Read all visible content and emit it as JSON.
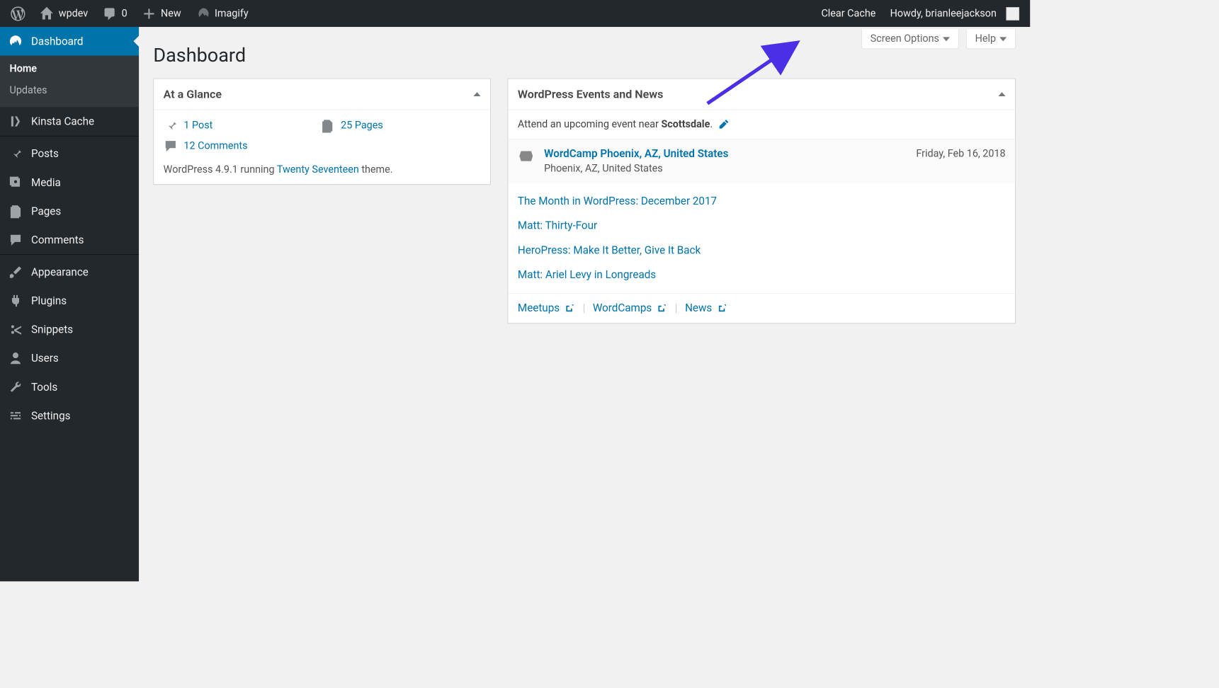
{
  "admin_bar": {
    "site_name": "wpdev",
    "comments_count": "0",
    "new_label": "New",
    "imagify_label": "Imagify",
    "clear_cache_label": "Clear Cache",
    "howdy_prefix": "Howdy, ",
    "username": "brianleejackson"
  },
  "sidebar": {
    "items": [
      {
        "label": "Dashboard",
        "icon": "dashboard",
        "current": true,
        "sub": [
          {
            "label": "Home",
            "current": true
          },
          {
            "label": "Updates",
            "current": false
          }
        ]
      },
      {
        "label": "Kinsta Cache",
        "icon": "kinsta"
      },
      {
        "label": "Posts",
        "icon": "pin"
      },
      {
        "label": "Media",
        "icon": "media"
      },
      {
        "label": "Pages",
        "icon": "pages"
      },
      {
        "label": "Comments",
        "icon": "comment"
      },
      {
        "label": "Appearance",
        "icon": "brush"
      },
      {
        "label": "Plugins",
        "icon": "plug"
      },
      {
        "label": "Snippets",
        "icon": "scissors"
      },
      {
        "label": "Users",
        "icon": "user"
      },
      {
        "label": "Tools",
        "icon": "wrench"
      },
      {
        "label": "Settings",
        "icon": "sliders"
      }
    ]
  },
  "page": {
    "title": "Dashboard",
    "screen_options_label": "Screen Options",
    "help_label": "Help"
  },
  "glance": {
    "heading": "At a Glance",
    "posts": "1 Post",
    "pages": "25 Pages",
    "comments": "12 Comments",
    "running_prefix": "WordPress 4.9.1 running ",
    "theme_link": "Twenty Seventeen",
    "running_suffix": " theme."
  },
  "events": {
    "heading": "WordPress Events and News",
    "near_prefix": "Attend an upcoming event near ",
    "near_location": "Scottsdale",
    "near_suffix": ".",
    "event": {
      "title": "WordCamp Phoenix, AZ, United States",
      "location": "Phoenix, AZ, United States",
      "date": "Friday, Feb 16, 2018"
    },
    "news": [
      "The Month in WordPress: December 2017",
      "Matt: Thirty-Four",
      "HeroPress: Make It Better, Give It Back",
      "Matt: Ariel Levy in Longreads"
    ],
    "footer": {
      "meetups": "Meetups",
      "wordcamps": "WordCamps",
      "news_link": "News"
    }
  }
}
